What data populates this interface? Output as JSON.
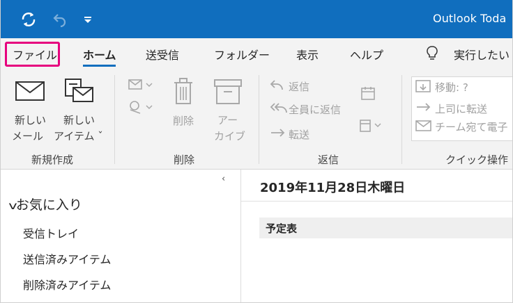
{
  "app": {
    "title": "Outlook Toda"
  },
  "colors": {
    "accent": "#106ebe",
    "highlight": "#e6007e"
  },
  "tabs": {
    "file": "ファイル",
    "home": "ホーム",
    "send_receive": "送受信",
    "folder": "フォルダー",
    "view": "表示",
    "help": "ヘルプ",
    "tell_me": "実行したい"
  },
  "ribbon": {
    "new": {
      "new_mail_line1": "新しい",
      "new_mail_line2": "メール",
      "new_item_line1": "新しい",
      "new_item_line2": "アイテム ˇ",
      "group": "新規作成"
    },
    "delete": {
      "delete_label": "削除",
      "archive_line1": "アー",
      "archive_line2": "カイブ",
      "group": "削除"
    },
    "respond": {
      "reply": "返信",
      "reply_all": "全員に返信",
      "forward": "転送",
      "group": "返信"
    },
    "quick_steps": {
      "move": "移動: ?",
      "to_manager": "上司に転送",
      "team_email": "チーム宛て電子",
      "group": "クイック操作"
    }
  },
  "nav": {
    "collapse_glyph": "‹",
    "favorites": "お気に入り",
    "folders": [
      "受信トレイ",
      "送信済みアイテム",
      "削除済みアイテム"
    ]
  },
  "main": {
    "date": "2019年11月28日木曜日",
    "calendar_header": "予定表"
  }
}
